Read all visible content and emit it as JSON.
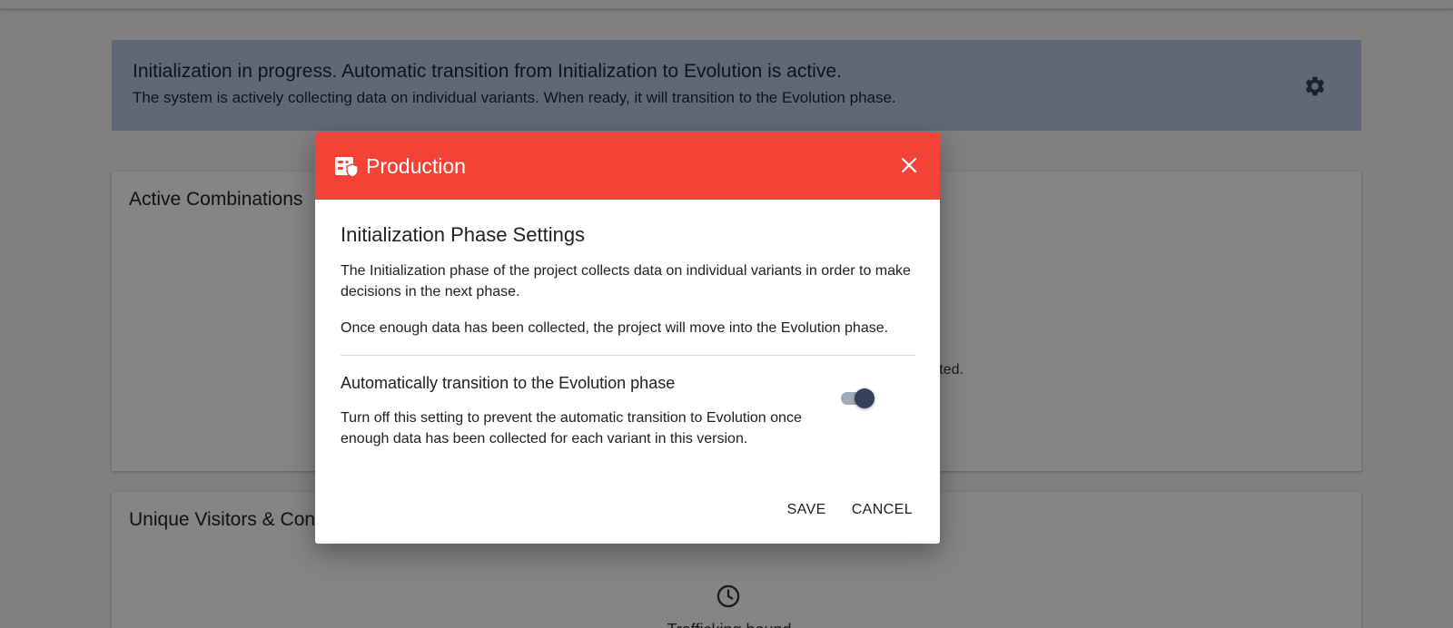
{
  "banner": {
    "title": "Initialization in progress. Automatic transition from Initialization to Evolution is active.",
    "text": "The system is actively collecting data on individual variants. When ready, it will transition to the Evolution phase.",
    "settings_icon": "gear-icon"
  },
  "cards": {
    "active_title": "Active Combinations",
    "active_note": "orted.",
    "visitors_title": "Unique Visitors & Conversions",
    "visitors_icon": "clock-icon",
    "visitors_sub": "Trafficking bound"
  },
  "dialog": {
    "header_title": "Production",
    "header_icon": "production-icon",
    "header_color": "#f44336",
    "heading": "Initialization Phase Settings",
    "para1": "The Initialization phase of the project collects data on individual variants in order to make decisions in the next phase.",
    "para2": "Once enough data has been collected, the project will move into the Evolution phase.",
    "setting": {
      "title": "Automatically transition to the Evolution phase",
      "description": "Turn off this setting to prevent the automatic transition to Evolution once enough data has been collected for each variant in this version.",
      "enabled": true
    },
    "save_label": "SAVE",
    "cancel_label": "CANCEL"
  }
}
